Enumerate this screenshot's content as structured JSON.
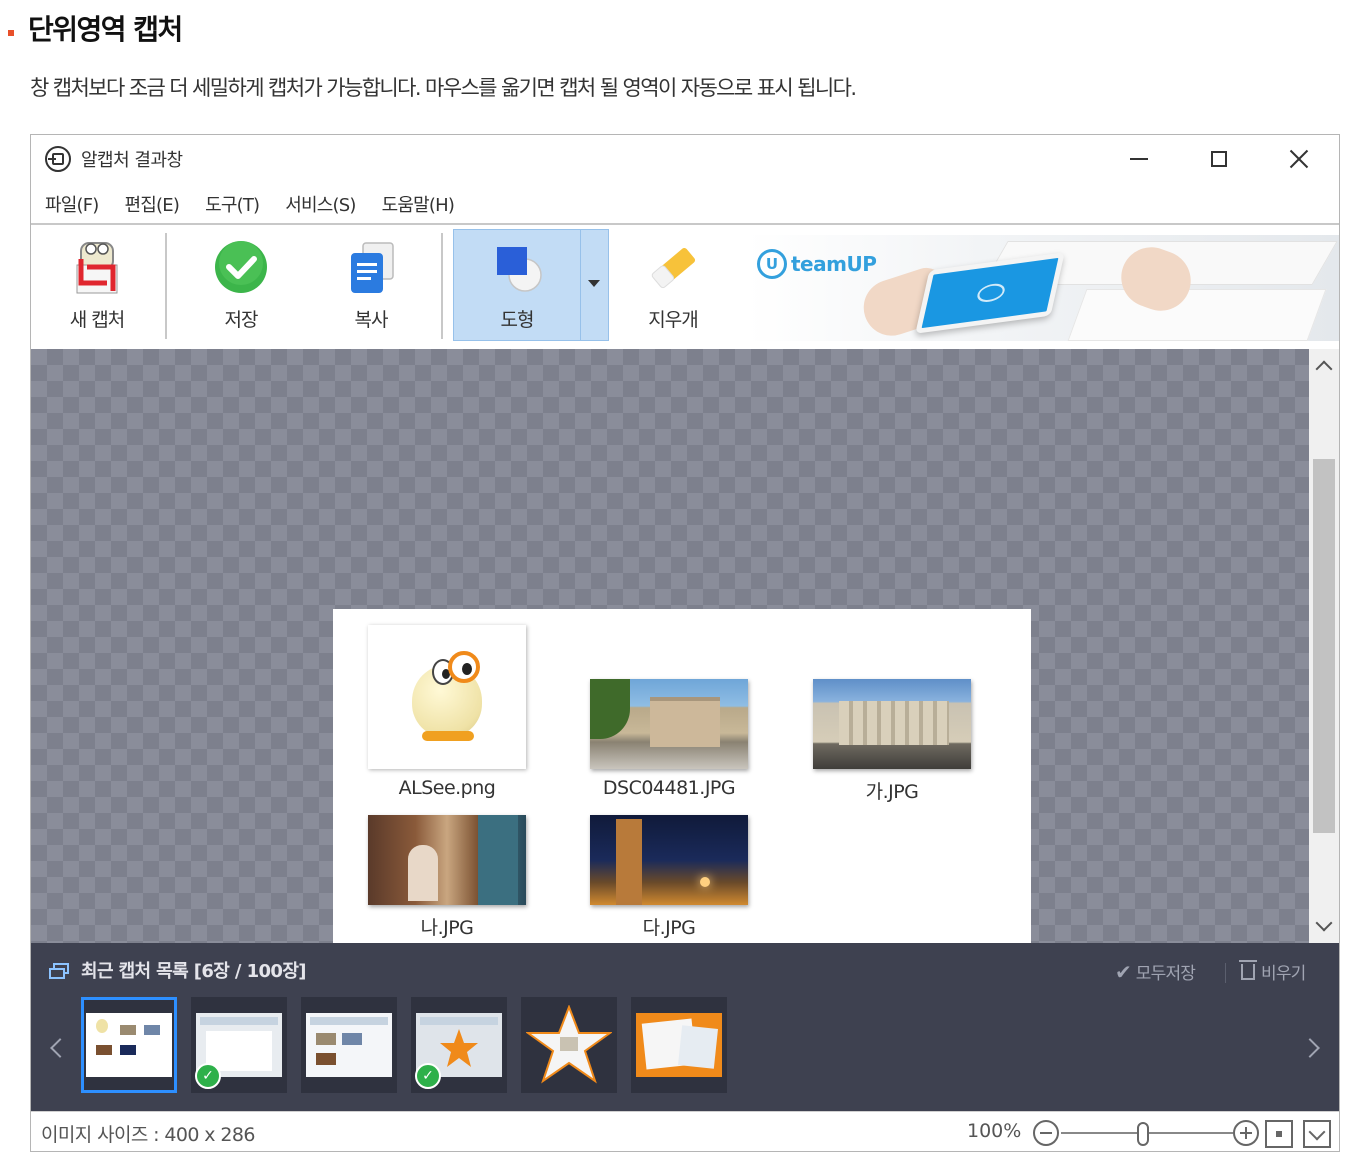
{
  "section": {
    "title": "단위영역 캡처",
    "description": "창 캡처보다 조금 더 세밀하게 캡처가 가능합니다. 마우스를 옮기면 캡처 될 영역이 자동으로 표시 됩니다."
  },
  "window": {
    "title": "알캡처 결과창"
  },
  "menu": [
    "파일(F)",
    "편집(E)",
    "도구(T)",
    "서비스(S)",
    "도움말(H)"
  ],
  "toolbar": {
    "new_capture": "새 캡처",
    "save": "저장",
    "copy": "복사",
    "shape": "도형",
    "eraser": "지우개"
  },
  "ad": {
    "logo_text": "teamUP"
  },
  "capture_files": [
    {
      "name": "ALSee.png"
    },
    {
      "name": "DSC04481.JPG"
    },
    {
      "name": "가.JPG"
    },
    {
      "name": "나.JPG"
    },
    {
      "name": "다.JPG"
    }
  ],
  "recent": {
    "title": "최근 캡처 목록 [6장 / 100장]",
    "save_all": "모두저장",
    "clear": "비우기"
  },
  "status": {
    "image_size": "이미지 사이즈 : 400 x 286",
    "zoom": "100%"
  },
  "colors": {
    "accent": "#e8502a",
    "selection": "#2d8fff",
    "check_green": "#2eb04a",
    "panel_bg": "#3e4150"
  },
  "icons": {
    "new_capture": "crop-icon",
    "save": "check-circle-icon",
    "copy": "copy-icon",
    "shape": "shape-icon",
    "eraser": "eraser-icon"
  }
}
